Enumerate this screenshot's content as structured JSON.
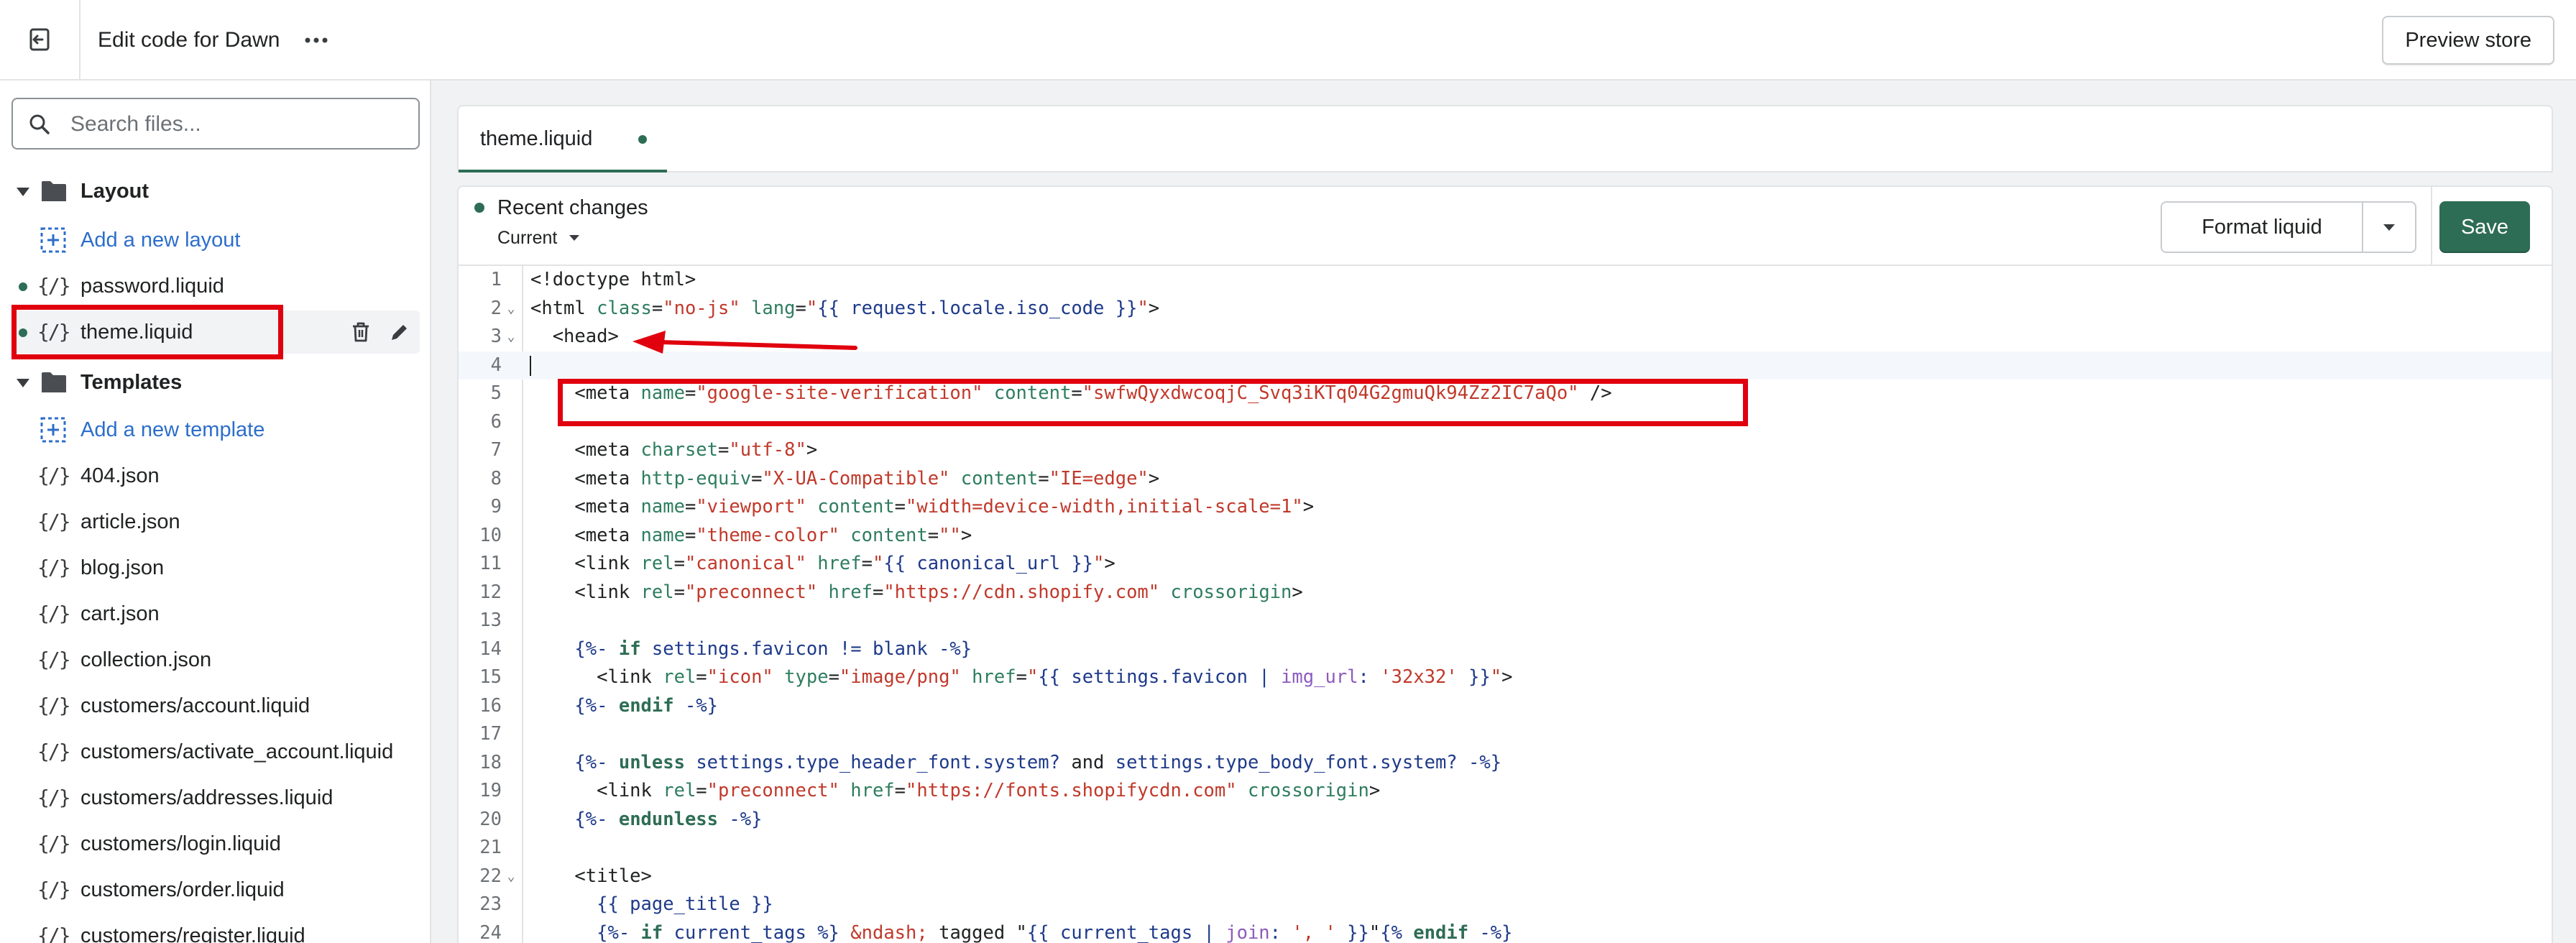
{
  "topbar": {
    "title": "Edit code for Dawn",
    "preview_label": "Preview store"
  },
  "sidebar": {
    "search_placeholder": "Search files...",
    "layout_folder": "Layout",
    "add_layout": "Add a new layout",
    "layout_files": [
      "password.liquid",
      "theme.liquid"
    ],
    "templates_folder": "Templates",
    "add_template": "Add a new template",
    "template_files": [
      "404.json",
      "article.json",
      "blog.json",
      "cart.json",
      "collection.json",
      "customers/account.liquid",
      "customers/activate_account.liquid",
      "customers/addresses.liquid",
      "customers/login.liquid",
      "customers/order.liquid",
      "customers/register.liquid"
    ]
  },
  "editor": {
    "tab_label": "theme.liquid",
    "recent_changes_label": "Recent changes",
    "version_select": "Current",
    "format_label": "Format liquid",
    "save_label": "Save"
  },
  "code": {
    "line_numbers": [
      "1",
      "2",
      "3",
      "4",
      "5",
      "6",
      "7",
      "8",
      "9",
      "10",
      "11",
      "12",
      "13",
      "14",
      "15",
      "16",
      "17",
      "18",
      "19",
      "20",
      "21",
      "22",
      "23",
      "24"
    ],
    "foldable_lines": [
      "2",
      "3",
      "22"
    ]
  },
  "colors": {
    "accent": "#2e6d55",
    "annotation": "#e0000e",
    "link": "#2c6ecb"
  }
}
